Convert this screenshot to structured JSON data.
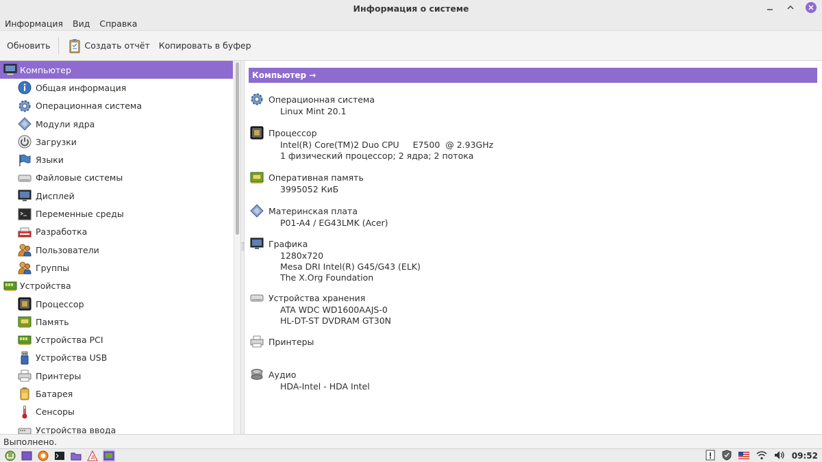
{
  "window": {
    "title": "Информация о системе"
  },
  "menu": {
    "items": [
      "Информация",
      "Вид",
      "Справка"
    ]
  },
  "toolbar": {
    "refresh": "Обновить",
    "report": "Создать отчёт",
    "copy": "Копировать в буфер"
  },
  "sidebar": {
    "items": [
      {
        "label": "Компьютер",
        "icon": "computer-icon"
      },
      {
        "label": "Общая информация",
        "icon": "info-icon"
      },
      {
        "label": "Операционная система",
        "icon": "gear-icon"
      },
      {
        "label": "Модули ядра",
        "icon": "diamond-icon"
      },
      {
        "label": "Загрузки",
        "icon": "power-icon"
      },
      {
        "label": "Языки",
        "icon": "flag-icon"
      },
      {
        "label": "Файловые системы",
        "icon": "drive-icon"
      },
      {
        "label": "Дисплей",
        "icon": "monitor-icon"
      },
      {
        "label": "Переменные среды",
        "icon": "terminal-icon"
      },
      {
        "label": "Разработка",
        "icon": "dev-icon"
      },
      {
        "label": "Пользователи",
        "icon": "users-icon"
      },
      {
        "label": "Группы",
        "icon": "group-icon"
      },
      {
        "label": "Устройства",
        "icon": "board-icon"
      },
      {
        "label": "Процессор",
        "icon": "cpu-icon"
      },
      {
        "label": "Память",
        "icon": "memory-icon"
      },
      {
        "label": "Устройства PCI",
        "icon": "pci-icon"
      },
      {
        "label": "Устройства USB",
        "icon": "usb-icon"
      },
      {
        "label": "Принтеры",
        "icon": "printer-icon"
      },
      {
        "label": "Батарея",
        "icon": "battery-icon"
      },
      {
        "label": "Сенсоры",
        "icon": "thermometer-icon"
      },
      {
        "label": "Устройства ввода",
        "icon": "input-icon"
      }
    ]
  },
  "main": {
    "header": "Компьютер →",
    "sections": [
      {
        "title": "Операционная система",
        "icon": "gear-icon",
        "lines": [
          "Linux Mint 20.1"
        ]
      },
      {
        "title": "Процессор",
        "icon": "cpu-icon",
        "lines": [
          "Intel(R) Core(TM)2 Duo CPU     E7500  @ 2.93GHz",
          "1 физический процессор; 2 ядра; 2 потока"
        ]
      },
      {
        "title": "Оперативная память",
        "icon": "memory-icon",
        "lines": [
          "3995052 КиБ"
        ]
      },
      {
        "title": "Материнская плата",
        "icon": "diamond-icon",
        "lines": [
          "P01-A4 / EG43LMK (Acer)"
        ]
      },
      {
        "title": "Графика",
        "icon": "monitor-icon",
        "lines": [
          "1280x720",
          "Mesa DRI Intel(R) G45/G43 (ELK)",
          "The X.Org Foundation"
        ]
      },
      {
        "title": "Устройства хранения",
        "icon": "drive-icon",
        "lines": [
          "ATA WDC WD1600AAJS-0",
          "HL-DT-ST DVDRAM GT30N"
        ]
      },
      {
        "title": "Принтеры",
        "icon": "printer-icon",
        "lines": []
      },
      {
        "title": "Аудио",
        "icon": "audio-icon",
        "lines": [
          "HDA-Intel - HDA Intel"
        ]
      }
    ]
  },
  "status": {
    "text": "Выполнено."
  },
  "taskbar": {
    "clock": "09:52"
  },
  "colors": {
    "accent": "#8d6bcf"
  }
}
